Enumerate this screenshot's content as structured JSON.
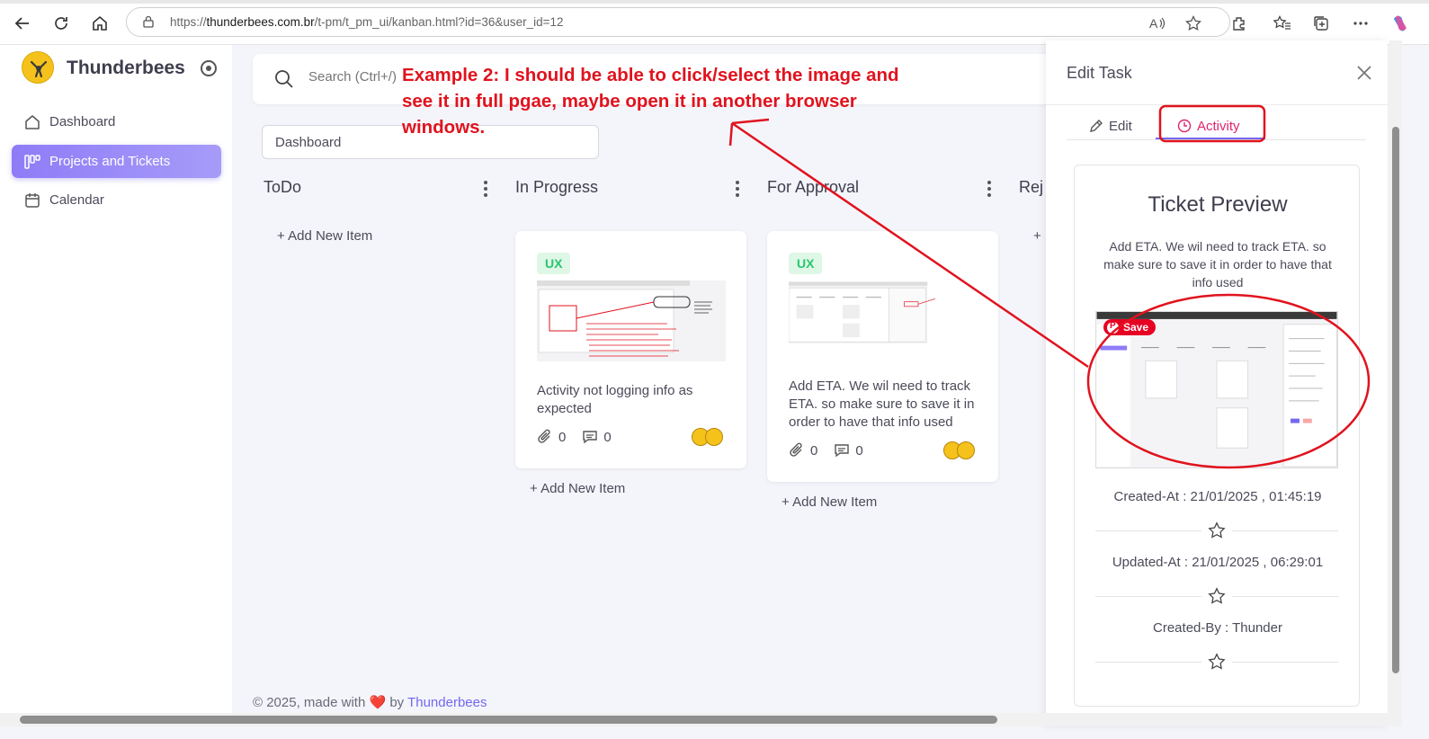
{
  "browser": {
    "url_prefix": "https://",
    "url_host": "thunderbees.com.br",
    "url_path": "/t-pm/t_pm_ui/kanban.html?id=36&user_id=12"
  },
  "sidebar": {
    "brand": "Thunderbees",
    "items": [
      {
        "label": "Dashboard"
      },
      {
        "label": "Projects and Tickets"
      },
      {
        "label": "Calendar"
      }
    ]
  },
  "search": {
    "placeholder": "Search (Ctrl+/)"
  },
  "board_select": {
    "value": "Dashboard"
  },
  "columns": [
    {
      "title": "ToDo",
      "add_label": "+ Add New Item"
    },
    {
      "title": "In Progress",
      "add_label": "+ Add New Item"
    },
    {
      "title": "For Approval",
      "add_label": "+ Add New Item"
    },
    {
      "title": "Rej",
      "add_label": "+"
    }
  ],
  "cards": [
    {
      "badge": "UX",
      "text": "Activity not logging info as expected",
      "attachments": "0",
      "comments": "0"
    },
    {
      "badge": "UX",
      "text": "Add ETA. We wil need to track ETA. so make sure to save it in order to have that info used",
      "attachments": "0",
      "comments": "0"
    }
  ],
  "footer": {
    "prefix": "© 2025, made with",
    "heart": "❤️",
    "by": "by",
    "link": "Thunderbees"
  },
  "panel": {
    "title": "Edit Task",
    "tabs": [
      {
        "label": "Edit"
      },
      {
        "label": "Activity"
      }
    ],
    "preview_title": "Ticket Preview",
    "preview_desc": "Add ETA. We wil need to track ETA. so make sure to save it in order to have that info used",
    "pin_save": "Save",
    "created_at": "Created-At : 21/01/2025 , 01:45:19",
    "updated_at": "Updated-At : 21/01/2025 , 06:29:01",
    "created_by": "Created-By : Thunder"
  },
  "annotation": {
    "text": "Example 2: I should be able to click/select the image and see it in full pgae, maybe open it in another browser windows.",
    "color": "#e0131e"
  },
  "colors": {
    "accent": "#7367f0",
    "annotation_red": "#e0131e",
    "badge_green": "#28c76f"
  }
}
